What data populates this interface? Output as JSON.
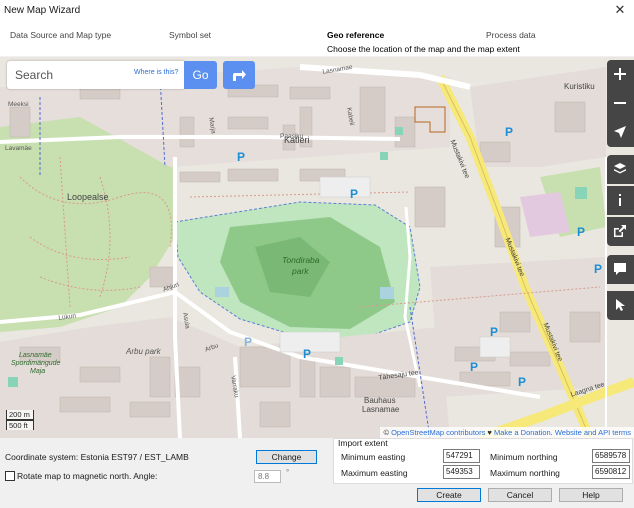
{
  "window": {
    "title": "New Map Wizard",
    "close_symbol": "✕"
  },
  "steps": [
    {
      "label": "Data Source and Map type"
    },
    {
      "label": "Symbol set"
    },
    {
      "label": "Geo reference"
    },
    {
      "label": "Process data"
    }
  ],
  "step_description": "Choose the location of the map and the map extent",
  "search": {
    "placeholder": "Search",
    "where_link": "Where is this?",
    "go_label": "Go"
  },
  "map": {
    "labels": {
      "kuristiku": "Kuristiku",
      "katleri": "Katleri",
      "loopealse": "Loopealse",
      "tondiraba": "Tondiraba",
      "park": "park",
      "arbu_park": "Arbu park",
      "lasnamae_sport_1": "Lasnamäe",
      "lasnamae_sport_2": "Spordimängude",
      "lasnamae_sport_3": "Maja",
      "bauhaus_1": "Bauhaus",
      "bauhaus_2": "Lasnamae",
      "mustakivi_1": "Mustakivi tee",
      "mustakivi_2": "Mustakivi tee",
      "mustakivi_3": "Mustakivi tee",
      "tahesaju": "Tähesaju tee",
      "paasiku": "Paasiku",
      "lukuri": "Lükuri",
      "ahjuri": "Ahjuri",
      "arbu": "Arbu",
      "varraku": "Varraku",
      "laagna": "Laagna tee",
      "lasnamae_street": "Lasnamae",
      "meekuti": "Meeksi",
      "lavamae": "Lavamäe",
      "marja": "Marja",
      "kabeli": "Kabeli",
      "asula": "Asula",
      "parking": "P"
    },
    "scale": {
      "metric": "200 m",
      "imperial": "500 ft"
    },
    "attribution": {
      "copyright": "©",
      "osm": "OpenStreetMap",
      "contributors": "contributors",
      "heart": "♥",
      "donation": "Make a Donation",
      "website": "Website and API terms"
    },
    "tools": [
      {
        "name": "zoom-in-icon"
      },
      {
        "name": "zoom-out-icon"
      },
      {
        "name": "locate-arrow-icon"
      },
      {
        "name": "layers-icon"
      },
      {
        "name": "info-icon"
      },
      {
        "name": "share-icon"
      },
      {
        "name": "comment-icon"
      },
      {
        "name": "query-cursor-icon"
      }
    ]
  },
  "coordinate_system": {
    "label": "Coordinate system: Estonia EST97 / EST_LAMB",
    "change_button": "Change"
  },
  "rotate": {
    "label": "Rotate map to magnetic north. Angle:",
    "angle_value": "8.8",
    "degree_symbol": "°",
    "checked": false
  },
  "import_extent": {
    "title": "Import extent",
    "min_easting_label": "Minimum easting",
    "min_easting": "547291",
    "max_easting_label": "Maximum easting",
    "max_easting": "549353",
    "min_northing_label": "Minimum northing",
    "min_northing": "6589578",
    "max_northing_label": "Maximum northing",
    "max_northing": "6590812"
  },
  "buttons": {
    "create": "Create",
    "cancel": "Cancel",
    "help": "Help"
  }
}
